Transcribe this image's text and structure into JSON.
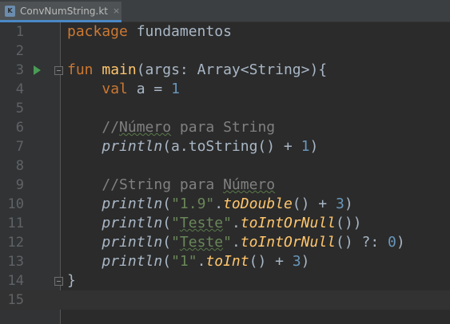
{
  "tab": {
    "file_icon_letter": "K",
    "title": "ConvNumString.kt",
    "close": "×"
  },
  "lines": [
    {
      "number": "1"
    },
    {
      "number": "2"
    },
    {
      "number": "3"
    },
    {
      "number": "4"
    },
    {
      "number": "5"
    },
    {
      "number": "6"
    },
    {
      "number": "7"
    },
    {
      "number": "8"
    },
    {
      "number": "9"
    },
    {
      "number": "10"
    },
    {
      "number": "11"
    },
    {
      "number": "12"
    },
    {
      "number": "13"
    },
    {
      "number": "14"
    },
    {
      "number": "15"
    }
  ],
  "code": {
    "l1": {
      "kw": "package",
      "rest": " fundamentos"
    },
    "l3": {
      "kw": "fun",
      "sp": " ",
      "fn": "main",
      "rest": "(args: Array<String>){"
    },
    "l4": {
      "indent": "    ",
      "kw": "val",
      "mid": " a = ",
      "num": "1"
    },
    "l6": {
      "indent": "    ",
      "c1": "//",
      "c2": "Número",
      "c3": " para String"
    },
    "l7": {
      "indent": "    ",
      "call": "println",
      "a": "(a.toString() + ",
      "num": "1",
      "b": ")"
    },
    "l9": {
      "indent": "    ",
      "c1": "//String para ",
      "c2": "Número"
    },
    "l10": {
      "indent": "    ",
      "call": "println",
      "p1": "(",
      "str": "\"1.9\"",
      "dot": ".",
      "ext": "toDouble",
      "p2": "() + ",
      "num": "3",
      "p3": ")"
    },
    "l11": {
      "indent": "    ",
      "call": "println",
      "p1": "(",
      "str1": "\"",
      "str2": "Teste",
      "str3": "\"",
      "dot": ".",
      "ext": "toIntOrNull",
      "p2": "())"
    },
    "l12": {
      "indent": "    ",
      "call": "println",
      "p1": "(",
      "str1": "\"",
      "str2": "Teste",
      "str3": "\"",
      "dot": ".",
      "ext": "toIntOrNull",
      "p2": "() ?: ",
      "num": "0",
      "p3": ")"
    },
    "l13": {
      "indent": "    ",
      "call": "println",
      "p1": "(",
      "str": "\"1\"",
      "dot": ".",
      "ext": "toInt",
      "p2": "() + ",
      "num": "3",
      "p3": ")"
    },
    "l14": {
      "brace": "}"
    }
  },
  "colors": {
    "keyword": "#cc7832",
    "function": "#ffc66d",
    "number": "#6897bb",
    "string": "#6a8759",
    "comment": "#808080",
    "text": "#a9b7c6",
    "background": "#2b2b2b",
    "run_arrow": "#499c54"
  },
  "icons": {
    "run": "run-arrow-icon",
    "fold": "fold-icon",
    "file": "kotlin-file-icon",
    "close": "close-icon"
  }
}
